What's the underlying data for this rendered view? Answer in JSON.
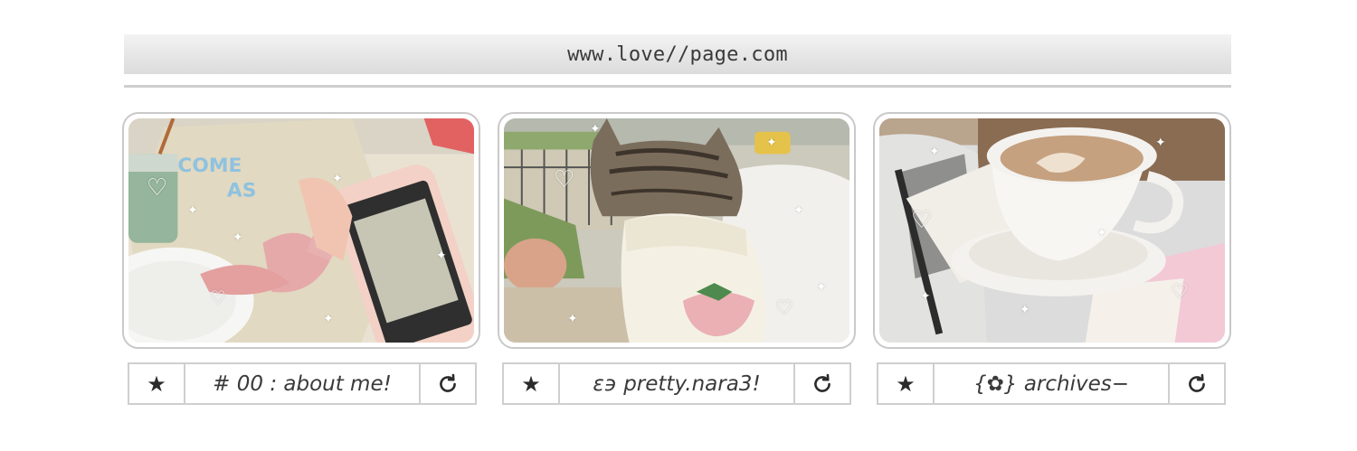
{
  "address_bar": {
    "url": "www.love//page.com"
  },
  "cards": [
    {
      "label": "# 00 : about me!",
      "photo": "embroidery-photo",
      "star_icon": "star-icon",
      "reload_icon": "refresh-icon"
    },
    {
      "label": "ε϶ pretty.nara3!",
      "photo": "cat-in-sweater-photo",
      "star_icon": "star-icon",
      "reload_icon": "refresh-icon"
    },
    {
      "label": "{✿} archives−",
      "photo": "coffee-cup-photo",
      "star_icon": "star-icon",
      "reload_icon": "refresh-icon"
    }
  ],
  "glyphs": {
    "star": "★",
    "sparkle": "✦",
    "heart": "♡"
  },
  "colors": {
    "frame_border": "#c9c9c9",
    "button_border": "#cfcfcf",
    "text": "#3a3a3a"
  }
}
